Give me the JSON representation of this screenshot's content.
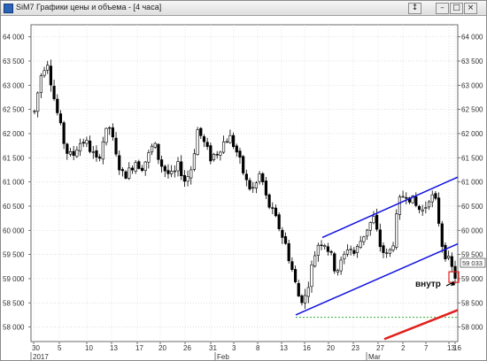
{
  "window": {
    "title": "SiM7 Графики цены и объема - [4 часа]",
    "buttons": {
      "scroll_label": "↕",
      "minimize_label": "–",
      "maximize_label": "□",
      "close_label": "×"
    }
  },
  "price_label": "59 033",
  "annotation": "внутр",
  "colors": {
    "up": "#ffffff",
    "down": "#000000",
    "channel": "#1010e0",
    "arrow_line": "#e0201c",
    "support": "#33aa33",
    "marker": "#e0201c"
  },
  "chart_data": {
    "type": "candlestick",
    "instrument": "SiM7",
    "timeframe": "4 часа",
    "y_ticks": [
      58000,
      58500,
      59000,
      59500,
      60000,
      60500,
      61000,
      61500,
      62000,
      62500,
      63000,
      63500,
      64000
    ],
    "y_tick_labels": [
      "58 000",
      "58 500",
      "59 000",
      "59 500",
      "60 000",
      "60 500",
      "61 000",
      "61 500",
      "62 000",
      "62 500",
      "63 000",
      "63 500",
      "64 000"
    ],
    "ylim": [
      57700,
      64250
    ],
    "x_day_labels": [
      "30",
      "5",
      "10",
      "13",
      "17",
      "20",
      "26",
      "31",
      "3",
      "8",
      "13",
      "16",
      "20",
      "23",
      "27",
      "2",
      "7",
      "13",
      "16"
    ],
    "x_period_labels": [
      "2017",
      "Feb",
      "Mar"
    ],
    "last_price": 59033,
    "channel_upper": [
      [
        0,
        59850
      ],
      [
        1,
        61100
      ]
    ],
    "channel_lower": [
      [
        0,
        58250
      ],
      [
        1,
        59720
      ]
    ],
    "support_level": 58200,
    "red_line": [
      [
        0,
        57750
      ],
      [
        1,
        58350
      ]
    ],
    "price_path": [
      62450,
      63200,
      63550,
      62800,
      62200,
      61650,
      61500,
      61800,
      61850,
      61650,
      61400,
      61900,
      62150,
      61500,
      61150,
      61200,
      61450,
      61300,
      61500,
      61800,
      61400,
      61200,
      61100,
      61350,
      61000,
      61300,
      62100,
      61800,
      61500,
      61600,
      61800,
      61950,
      61700,
      61300,
      60900,
      60850,
      61200,
      60600,
      60350,
      60050,
      59700,
      59200,
      58650,
      58550,
      59150,
      59700,
      59800,
      59550,
      59150,
      59350,
      59700,
      59500,
      59800,
      60050,
      60250,
      59700,
      59450,
      59650,
      60550,
      60800,
      60650,
      60450,
      60400,
      60750,
      60550,
      59650,
      59350,
      59050
    ]
  }
}
